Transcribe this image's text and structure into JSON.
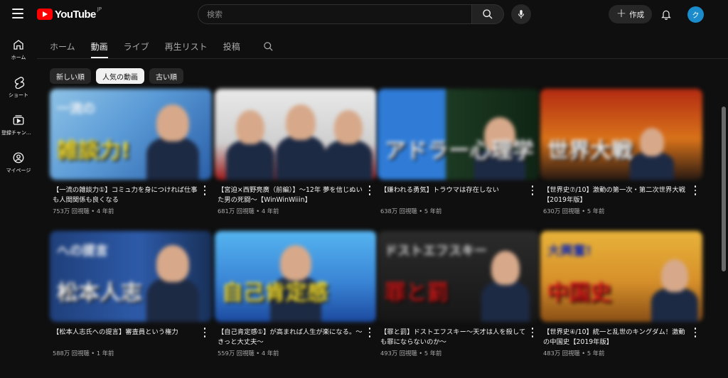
{
  "header": {
    "logo_text": "YouTube",
    "logo_region": "JP",
    "search_placeholder": "検索",
    "create_label": "作成",
    "avatar_initial": "ク"
  },
  "sidebar": {
    "items": [
      {
        "label": "ホーム",
        "icon": "home-icon"
      },
      {
        "label": "ショート",
        "icon": "shorts-icon"
      },
      {
        "label": "登録チャンネル",
        "icon": "subscriptions-icon"
      },
      {
        "label": "マイページ",
        "icon": "you-icon"
      }
    ]
  },
  "tabs": [
    {
      "label": "ホーム",
      "active": false
    },
    {
      "label": "動画",
      "active": true
    },
    {
      "label": "ライブ",
      "active": false
    },
    {
      "label": "再生リスト",
      "active": false
    },
    {
      "label": "投稿",
      "active": false
    }
  ],
  "chips": [
    {
      "label": "新しい順",
      "active": false
    },
    {
      "label": "人気の動画",
      "active": true
    },
    {
      "label": "古い順",
      "active": false
    }
  ],
  "videos": [
    {
      "title": "【一流の雑談力①】コミュ力を身につければ仕事も人間関係も良くなる",
      "views": "753万 回視聴",
      "age": "4 年前",
      "thumb": {
        "bg": "linear-gradient(135deg,#8fc3e6 0%,#5a9ad6 45%,#2a5fa8 100%)",
        "caption": "雑談力!",
        "caption_color": "#f7e135",
        "tag": "一流の",
        "tag_color": "#f4f4f4"
      }
    },
    {
      "title": "【宮迫×西野亮廣（前編）】〜12年 夢を信じぬいた男の死闘〜【WinWinWiiin】",
      "views": "681万 回視聴",
      "age": "4 年前",
      "thumb": {
        "bg": "linear-gradient(180deg,#e9e9e9 0%,#cfcfcf 60%,#9c1a1a 100%)",
        "caption": "",
        "caption_color": "#ffffff",
        "tag": "",
        "tag_color": "#ffffff"
      }
    },
    {
      "title": "【嫌われる勇気】トラウマは存在しない",
      "views": "638万 回視聴",
      "age": "5 年前",
      "thumb": {
        "bg": "linear-gradient(90deg,#2f7bd6 0%,#2f7bd6 42%,#1c3a22 42%,#0f2414 100%)",
        "caption": "アドラー心理学",
        "caption_color": "#f2f2f2",
        "tag": "",
        "tag_color": "#ffffff"
      }
    },
    {
      "title": "【世界史⑦/10】激動の第一次・第二次世界大戦【2019年版】",
      "views": "630万 回視聴",
      "age": "5 年前",
      "thumb": {
        "bg": "linear-gradient(180deg,#b32b12 0%,#d8721a 55%,#2a1a12 100%)",
        "caption": "世界大戦",
        "caption_color": "#ffffff",
        "tag": "",
        "tag_color": "#ffffff"
      }
    },
    {
      "title": "【松本人志氏への提言】審査員という権力",
      "views": "588万 回視聴",
      "age": "1 年前",
      "thumb": {
        "bg": "linear-gradient(90deg,#1f3f7a 0%,#2d5aa8 55%,#183058 100%)",
        "caption": "松本人志",
        "caption_color": "#f4f4f4",
        "tag": "への提言",
        "tag_color": "#f4f4f4"
      }
    },
    {
      "title": "【自己肯定感①】が高まれば人生が楽になる。〜きっと大丈夫〜",
      "views": "559万 回視聴",
      "age": "4 年前",
      "thumb": {
        "bg": "linear-gradient(180deg,#55b4f0 0%,#3a86d6 55%,#1c4aa0 100%)",
        "caption": "自己肯定感",
        "caption_color": "#f7e135",
        "tag": "",
        "tag_color": "#ffffff"
      }
    },
    {
      "title": "【罪と罰】ドストエフスキー〜天才は人を殺しても罪にならないのか〜",
      "views": "493万 回視聴",
      "age": "5 年前",
      "thumb": {
        "bg": "linear-gradient(180deg,#2b2b2b 0%,#161616 100%)",
        "caption": "罪と罰",
        "caption_color": "#c21818",
        "tag": "ドストエフスキー",
        "tag_color": "#dddddd"
      }
    },
    {
      "title": "【世界史④/10】統一と乱世のキングダム！激動の中国史【2019年版】",
      "views": "483万 回視聴",
      "age": "5 年前",
      "thumb": {
        "bg": "linear-gradient(180deg,#e8b33a 0%,#d7902a 55%,#8a4f16 100%)",
        "caption": "中国史",
        "caption_color": "#e01a1a",
        "tag": "大興奮!",
        "tag_color": "#1a2fa8"
      }
    }
  ]
}
